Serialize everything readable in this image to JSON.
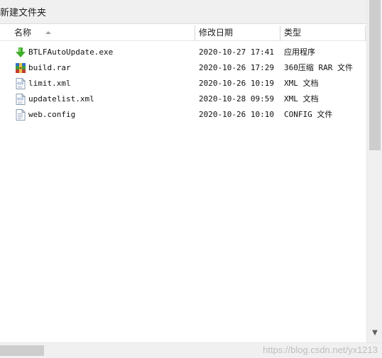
{
  "toolbar": {
    "new_folder_label": "新建文件夹"
  },
  "columns": {
    "name": "名称",
    "modified": "修改日期",
    "type": "类型"
  },
  "files": [
    {
      "name": "BTLFAutoUpdate.exe",
      "date": "2020-10-27 17:41",
      "type": "应用程序",
      "icon": "green-download-arrow-icon"
    },
    {
      "name": "build.rar",
      "date": "2020-10-26 17:29",
      "type": "360压缩 RAR 文件",
      "icon": "rar-archive-icon"
    },
    {
      "name": "limit.xml",
      "date": "2020-10-26 10:19",
      "type": "XML 文档",
      "icon": "xml-file-icon"
    },
    {
      "name": "updatelist.xml",
      "date": "2020-10-28 09:59",
      "type": "XML 文档",
      "icon": "xml-file-icon"
    },
    {
      "name": "web.config",
      "date": "2020-10-26 10:10",
      "type": "CONFIG 文件",
      "icon": "config-file-icon"
    }
  ],
  "watermark": "https://blog.csdn.net/yx1213",
  "colors": {
    "toolbar_bg": "#f0f0f0",
    "scrollbar_thumb": "#cdcdcd",
    "header_separator": "#d6d6d6"
  }
}
